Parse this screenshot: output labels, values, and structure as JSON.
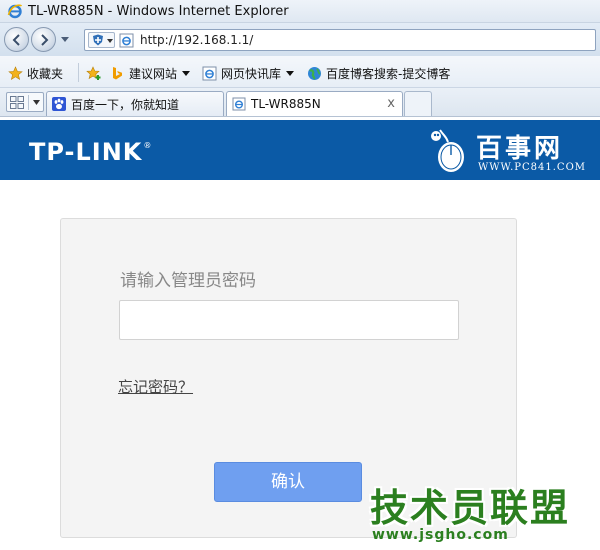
{
  "window": {
    "title": "TL-WR885N - Windows Internet Explorer"
  },
  "addressbar": {
    "url": "http://192.168.1.1/"
  },
  "favorites": {
    "favorites_label": "收藏夹",
    "items": [
      {
        "label": "建议网站",
        "icon": "bing-icon"
      },
      {
        "label": "网页快讯库",
        "icon": "web-slice-icon"
      },
      {
        "label": "百度博客搜索-提交博客",
        "icon": "globe-icon"
      }
    ]
  },
  "tabs": [
    {
      "label": "百度一下，你就知道",
      "icon": "baidu-paw-icon",
      "active": false
    },
    {
      "label": "TL-WR885N",
      "icon": "ie-page-icon",
      "active": true,
      "close": "x"
    }
  ],
  "banner": {
    "brand": "TP-LINK",
    "brand_mark": "®",
    "site_name": "百事网",
    "site_url": "WWW.PC841.COM",
    "color": "#0b5aa6"
  },
  "login": {
    "prompt": "请输入管理员密码",
    "password_value": "",
    "forgot_label": "忘记密码？",
    "confirm_label": "确认",
    "confirm_color": "#6f9ff0"
  },
  "watermark": {
    "title": "技术员联盟",
    "url": "www.jsgho.com",
    "color": "#2b7f1f"
  }
}
